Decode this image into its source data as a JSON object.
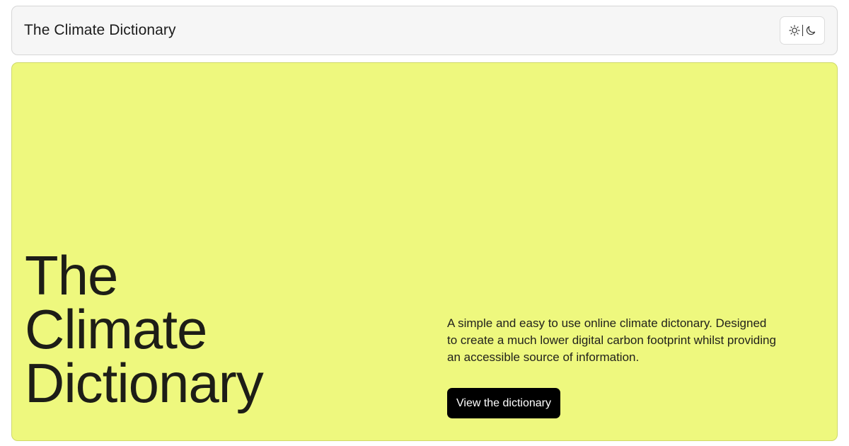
{
  "header": {
    "site_title": "The Climate Dictionary",
    "theme_toggle": {
      "icons": [
        "sun-icon",
        "moon-icon"
      ]
    }
  },
  "hero": {
    "title_lines": [
      "The",
      "Climate",
      "Dictionary"
    ],
    "description": "A simple and easy to use online climate dictonary. Designed to create a much lower digital carbon footprint whilst providing an accessible source of information.",
    "cta_label": "View the dictionary",
    "background_color": "#eef87e"
  }
}
